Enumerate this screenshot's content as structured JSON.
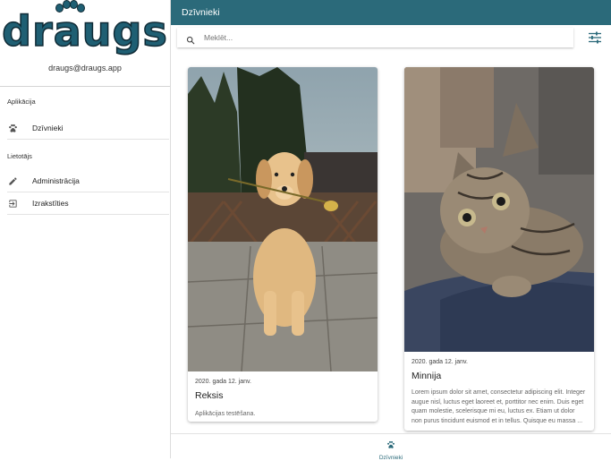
{
  "app": {
    "logo_text_a": "dr",
    "logo_text_b": "ugs",
    "logo_paw_letter": "a"
  },
  "sidebar": {
    "email": "draugs@draugs.app",
    "sections": [
      {
        "label": "Aplikācija",
        "items": [
          {
            "label": "Dzīvnieki",
            "icon": "paw-icon"
          }
        ]
      },
      {
        "label": "Lietotājs",
        "items": [
          {
            "label": "Administrācija",
            "icon": "pencil-icon"
          },
          {
            "label": "Izrakstīties",
            "icon": "logout-icon"
          }
        ]
      }
    ]
  },
  "header": {
    "title": "Dzīvnieki"
  },
  "search": {
    "placeholder": "Meklēt...",
    "value": ""
  },
  "cards": [
    {
      "date": "2020. gada 12. janv.",
      "title": "Reksis",
      "description": "Aplikācijas testēšana.",
      "image": "dog-photo"
    },
    {
      "date": "2020. gada 12. janv.",
      "title": "Minnija",
      "description": "Lorem ipsum dolor sit amet, consectetur adipiscing elit. Integer augue nisl, luctus eget laoreet et, porttitor nec enim. Duis eget quam molestie, scelerisque mi eu, luctus ex. Etiam ut dolor non purus tincidunt euismod et in tellus. Quisque eu massa ...",
      "image": "cat-photo"
    }
  ],
  "bottom_nav": {
    "label": "Dzīvnieki",
    "icon": "paw-icon"
  },
  "colors": {
    "primary": "#2b6a7a",
    "logo": "#1f5f73"
  }
}
